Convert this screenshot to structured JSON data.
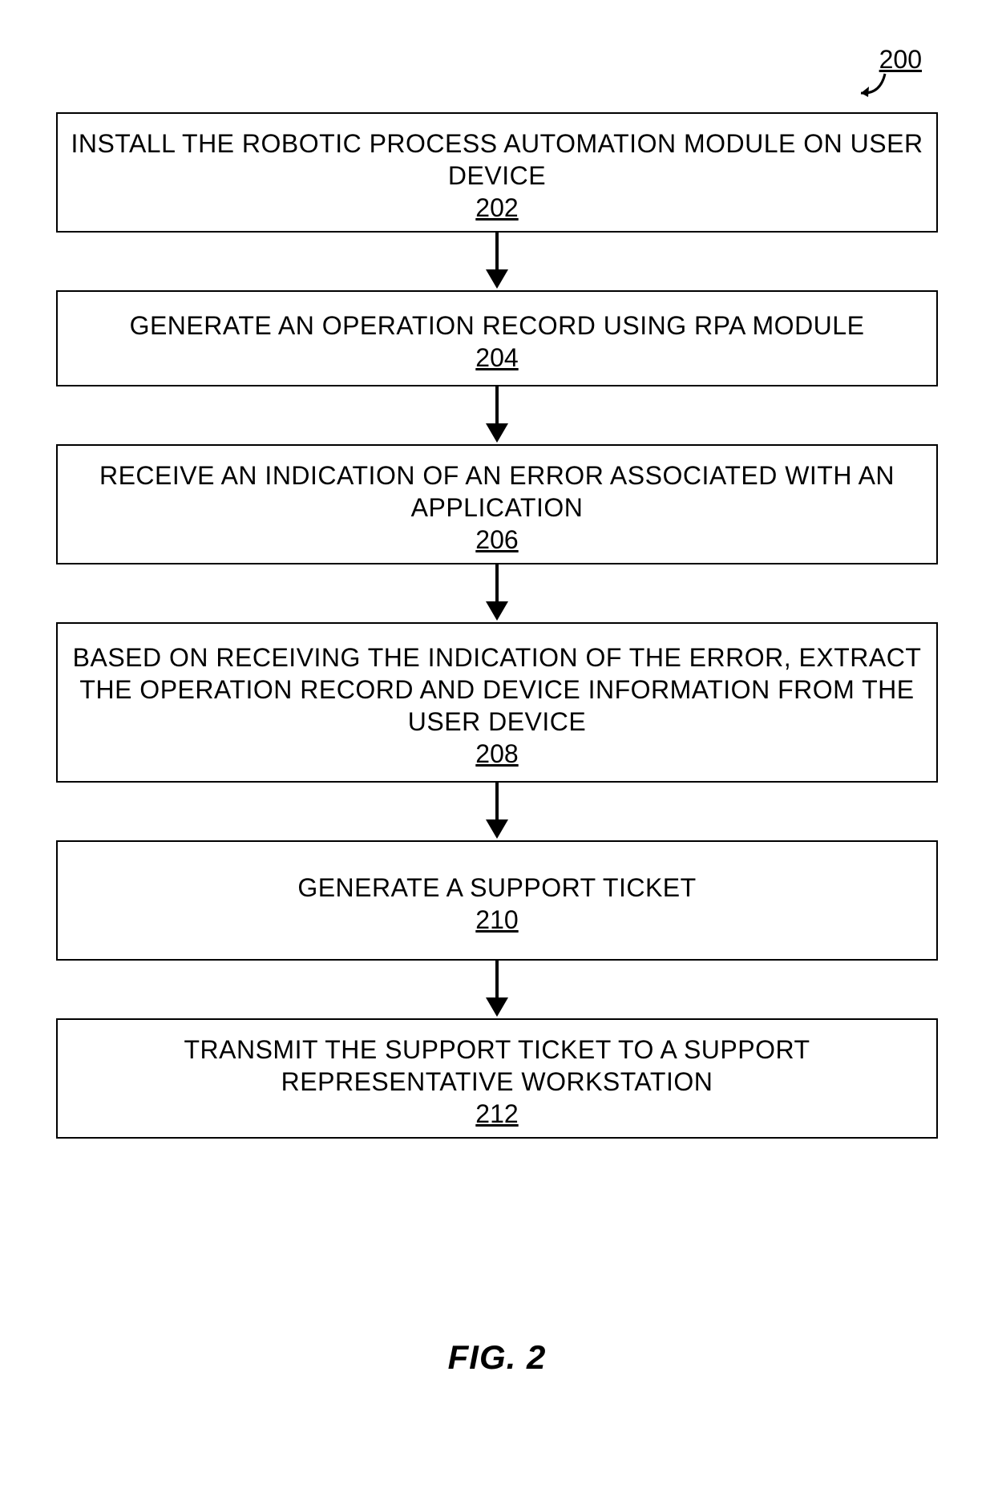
{
  "diagram": {
    "reference_number": "200",
    "caption": "FIG. 2",
    "steps": [
      {
        "text": "INSTALL THE ROBOTIC PROCESS AUTOMATION MODULE ON USER DEVICE",
        "number": "202"
      },
      {
        "text": "GENERATE AN OPERATION RECORD USING RPA MODULE",
        "number": "204"
      },
      {
        "text": "RECEIVE AN INDICATION OF AN ERROR ASSOCIATED WITH AN APPLICATION",
        "number": "206"
      },
      {
        "text": "BASED ON RECEIVING THE INDICATION OF THE ERROR, EXTRACT THE OPERATION RECORD AND DEVICE INFORMATION FROM THE USER DEVICE",
        "number": "208"
      },
      {
        "text": "GENERATE A SUPPORT TICKET",
        "number": "210"
      },
      {
        "text": "TRANSMIT THE SUPPORT TICKET TO A SUPPORT REPRESENTATIVE WORKSTATION",
        "number": "212"
      }
    ]
  }
}
